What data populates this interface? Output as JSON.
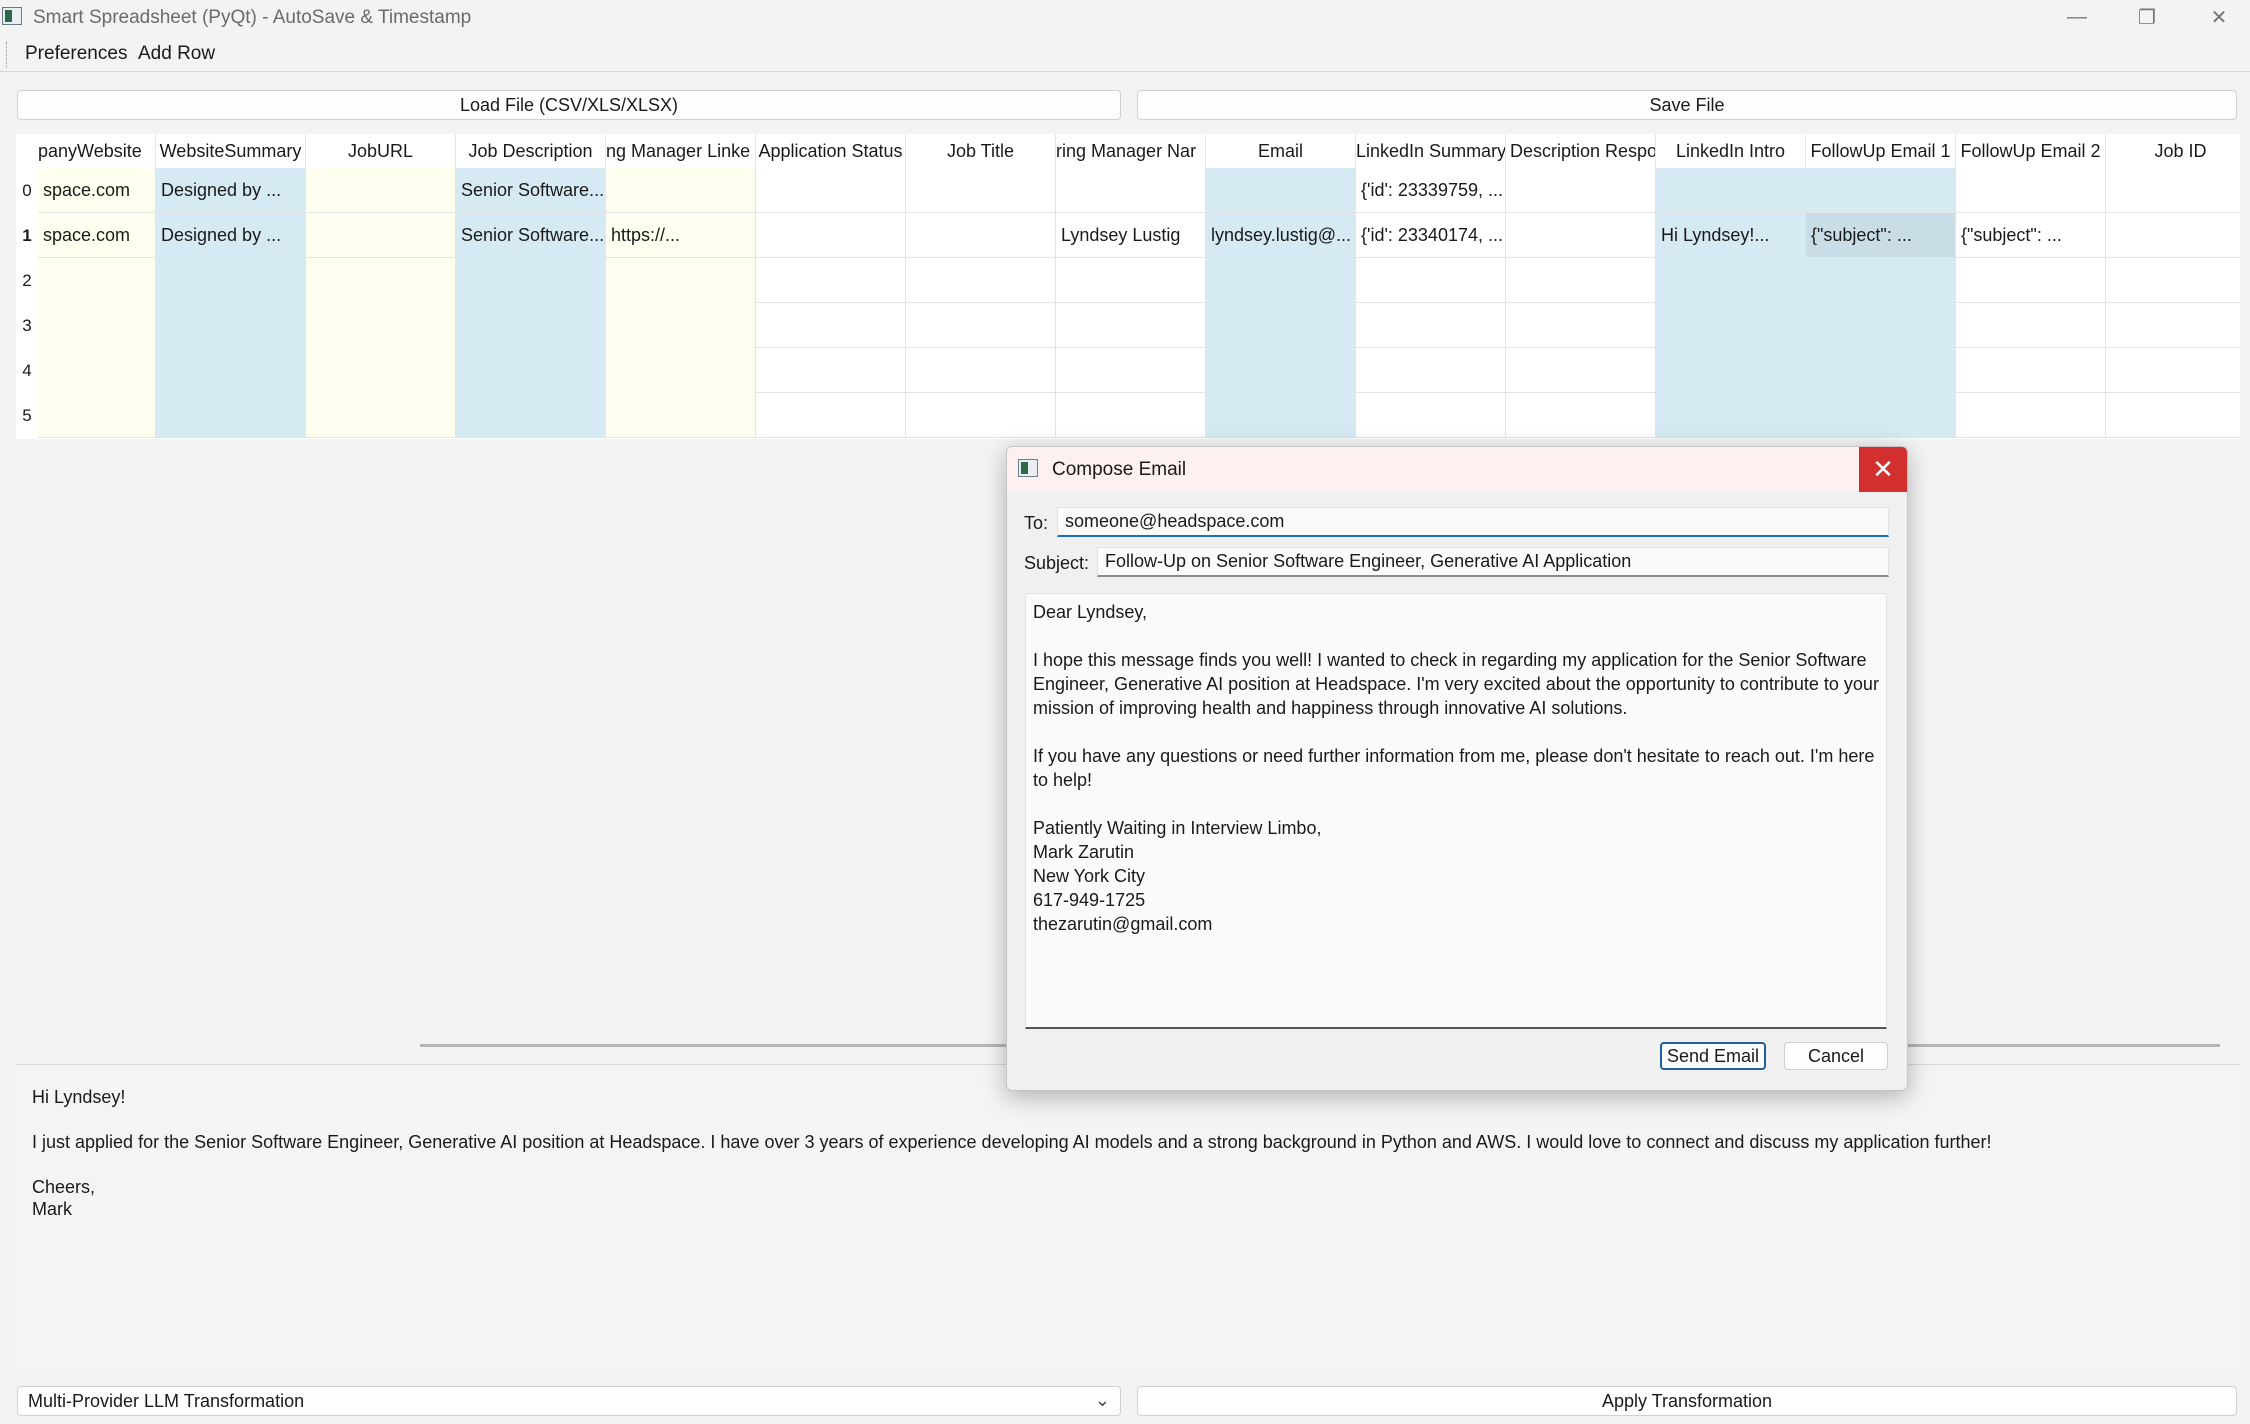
{
  "window": {
    "title": "Smart Spreadsheet (PyQt) - AutoSave & Timestamp"
  },
  "menu": {
    "preferences": "Preferences",
    "add_row": "Add Row"
  },
  "toolbar": {
    "load": "Load File (CSV/XLS/XLSX)",
    "save": "Save File"
  },
  "table": {
    "headers": [
      "panyWebsite",
      "WebsiteSummary",
      "JobURL",
      "Job Description",
      "ng Manager Linke",
      "Application Status",
      "Job Title",
      "ring Manager Nar",
      "Email",
      "LinkedIn Summary",
      "Description Respo",
      "LinkedIn Intro",
      "FollowUp Email 1",
      "FollowUp Email 2",
      "Job ID"
    ],
    "row_numbers": [
      "0",
      "1",
      "2",
      "3",
      "4",
      "5"
    ],
    "rows": [
      [
        "space.com",
        "Designed by ...",
        "",
        "Senior Software...",
        "",
        "",
        "",
        "",
        "",
        "{'id': 23339759, ...",
        "",
        "",
        "",
        "",
        ""
      ],
      [
        "space.com",
        "Designed by ...",
        "",
        "Senior Software...",
        "https://...",
        "",
        "",
        "Lyndsey Lustig",
        "lyndsey.lustig@...",
        "{'id': 23340174, ...",
        "",
        "Hi Lyndsey!...",
        "{\"subject\": ...",
        "{\"subject\": ...",
        ""
      ]
    ]
  },
  "preview": {
    "greeting": "Hi Lyndsey!",
    "body": "I just applied for the Senior Software Engineer, Generative AI position at Headspace. I have over 3 years of experience developing AI models and a strong background in Python and AWS. I would love to connect and discuss my application further!",
    "closing": "Cheers,",
    "name": "Mark"
  },
  "bottom": {
    "combo_value": "Multi-Provider LLM Transformation",
    "apply": "Apply Transformation"
  },
  "dialog": {
    "title": "Compose Email",
    "to_label": "To:",
    "to_value": "someone@headspace.com",
    "subject_label": "Subject:",
    "subject_value": "Follow-Up on Senior Software Engineer, Generative AI Application",
    "body": "Dear Lyndsey,\n\nI hope this message finds you well! I wanted to check in regarding my application for the Senior Software Engineer, Generative AI position at Headspace. I'm very excited about the opportunity to contribute to your mission of improving health and happiness through innovative AI solutions.\n\nIf you have any questions or need further information from me, please don't hesitate to reach out. I'm here to help!\n\nPatiently Waiting in Interview Limbo,\nMark Zarutin\nNew York City\n617-949-1725\nthezarutin@gmail.com",
    "send": "Send Email",
    "cancel": "Cancel"
  }
}
